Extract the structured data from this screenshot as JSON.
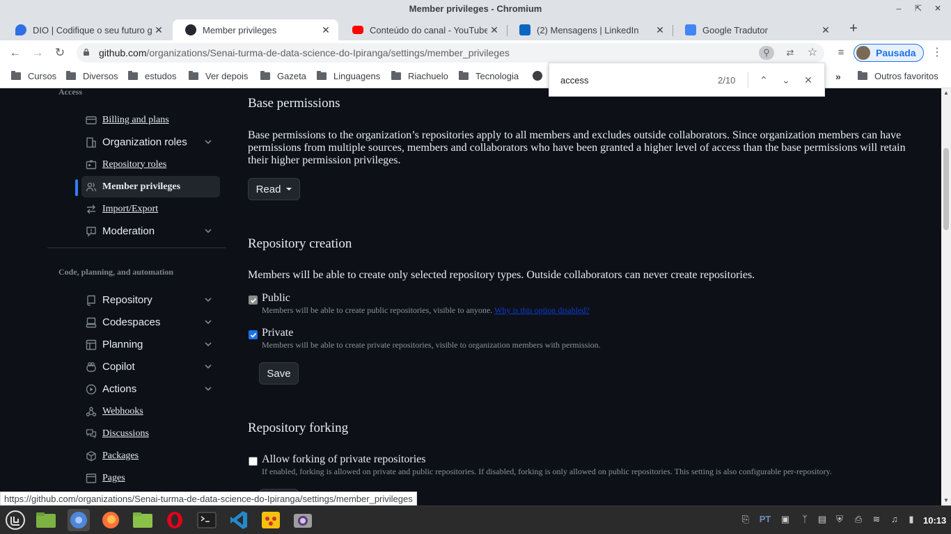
{
  "window": {
    "title": "Member privileges - Chromium"
  },
  "tabs": [
    {
      "title": "DIO | Codifique o seu futuro g",
      "favicon_color": "#2f6fe4"
    },
    {
      "title": "Member privileges",
      "favicon_color": "#24292f"
    },
    {
      "title": "Conteúdo do canal - YouTube",
      "favicon_color": "#ff0000"
    },
    {
      "title": "(2) Mensagens | LinkedIn",
      "favicon_color": "#0a66c2"
    },
    {
      "title": "Google Tradutor",
      "favicon_color": "#4285f4"
    }
  ],
  "address_bar": {
    "host": "github.com",
    "path": "/organizations/Senai-turma-de-data-science-do-Ipiranga/settings/member_privileges"
  },
  "profile": {
    "label": "Pausada"
  },
  "bookmarks": [
    "Cursos",
    "Diversos",
    "estudos",
    "Ver depois",
    "Gazeta",
    "Linguagens",
    "Riachuelo",
    "Tecnologia"
  ],
  "bookmarks_other": "Outros favoritos",
  "find_bar": {
    "query": "access",
    "count": "2/10"
  },
  "sidebar": {
    "heading_access": "Access",
    "heading_code": "Code, planning, and automation",
    "access_items": [
      {
        "label": "Billing and plans",
        "icon": "credit-card-icon",
        "expandable": false
      },
      {
        "label": "Organization roles",
        "icon": "organization-icon",
        "expandable": true
      },
      {
        "label": "Repository roles",
        "icon": "id-badge-icon",
        "expandable": false
      },
      {
        "label": "Member privileges",
        "icon": "people-icon",
        "expandable": false,
        "selected": true
      },
      {
        "label": "Import/Export",
        "icon": "arrow-switch-icon",
        "expandable": false
      },
      {
        "label": "Moderation",
        "icon": "report-icon",
        "expandable": true
      }
    ],
    "code_items": [
      {
        "label": "Repository",
        "icon": "repo-icon",
        "expandable": true
      },
      {
        "label": "Codespaces",
        "icon": "codespaces-icon",
        "expandable": true
      },
      {
        "label": "Planning",
        "icon": "table-icon",
        "expandable": true
      },
      {
        "label": "Copilot",
        "icon": "copilot-icon",
        "expandable": true
      },
      {
        "label": "Actions",
        "icon": "play-icon",
        "expandable": true
      },
      {
        "label": "Webhooks",
        "icon": "webhook-icon",
        "expandable": false
      },
      {
        "label": "Discussions",
        "icon": "comment-discussion-icon",
        "expandable": false
      },
      {
        "label": "Packages",
        "icon": "package-icon",
        "expandable": false
      },
      {
        "label": "Pages",
        "icon": "browser-icon",
        "expandable": false
      }
    ]
  },
  "main": {
    "base_permissions": {
      "title": "Base permissions",
      "description": "Base permissions to the organization’s repositories apply to all members and excludes outside collaborators. Since organization members can have permissions from multiple sources, members and collaborators who have been granted a higher level of access than the base permissions will retain their higher permission privileges.",
      "button_label": "Read"
    },
    "repository_creation": {
      "title": "Repository creation",
      "description": "Members will be able to create only selected repository types. Outside collaborators can never create repositories.",
      "public_label": "Public",
      "public_desc": "Members will be able to create public repositories, visible to anyone.",
      "public_link": "Why is this option disabled?",
      "private_label": "Private",
      "private_desc": "Members will be able to create private repositories, visible to organization members with permission.",
      "save_label": "Save"
    },
    "repository_forking": {
      "title": "Repository forking",
      "option_label": "Allow forking of private repositories",
      "option_desc": "If enabled, forking is allowed on private and public repositories. If disabled, forking is only allowed on public repositories. This setting is also configurable per-repository."
    }
  },
  "status_bar": {
    "url": "https://github.com/organizations/Senai-turma-de-data-science-do-Ipiranga/settings/member_privileges"
  },
  "taskbar": {
    "apps": [
      "menu-icon",
      "files-icon",
      "chromium-icon",
      "firefox-icon",
      "folder-icon",
      "opera-icon",
      "terminal-icon",
      "vscode-icon",
      "game-icon",
      "camera-icon"
    ],
    "keyboard_layout": "PT",
    "clock": "10:13"
  }
}
